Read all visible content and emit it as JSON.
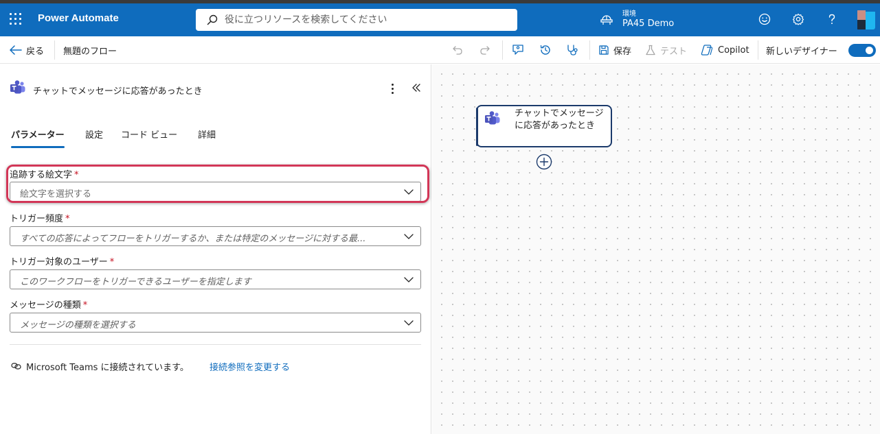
{
  "topbar": {
    "app_name": "Power Automate",
    "search_placeholder": "役に立つリソースを検索してください",
    "environment_label": "環境",
    "environment_name": "PA45 Demo"
  },
  "commandbar": {
    "back_label": "戻る",
    "flow_name": "無題のフロー",
    "save_label": "保存",
    "test_label": "テスト",
    "copilot_label": "Copilot",
    "new_designer_label": "新しいデザイナー"
  },
  "panel": {
    "title": "チャットでメッセージに応答があったとき",
    "tabs": [
      {
        "label": "パラメーター",
        "active": true
      },
      {
        "label": "設定",
        "active": false
      },
      {
        "label": "コード ビュー",
        "active": false
      },
      {
        "label": "詳細",
        "active": false
      }
    ],
    "fields": [
      {
        "label": "追跡する絵文字",
        "required": "*",
        "placeholder": "絵文字を選択する"
      },
      {
        "label": "トリガー頻度",
        "required": "*",
        "placeholder": "すべての応答によってフローをトリガーするか、または特定のメッセージに対する最..."
      },
      {
        "label": "トリガー対象のユーザー",
        "required": "*",
        "placeholder": "このワークフローをトリガーできるユーザーを指定します"
      },
      {
        "label": "メッセージの種類",
        "required": "*",
        "placeholder": "メッセージの種類を選択する"
      }
    ],
    "connection_text": "Microsoft Teams に接続されています。",
    "change_connection_label": "接続参照を変更する"
  },
  "canvas": {
    "node_title": "チャットでメッセージに応答があったとき"
  },
  "colors": {
    "brand": "#0f6cbd",
    "highlight": "#d23657",
    "node_border": "#1b3a6b"
  }
}
